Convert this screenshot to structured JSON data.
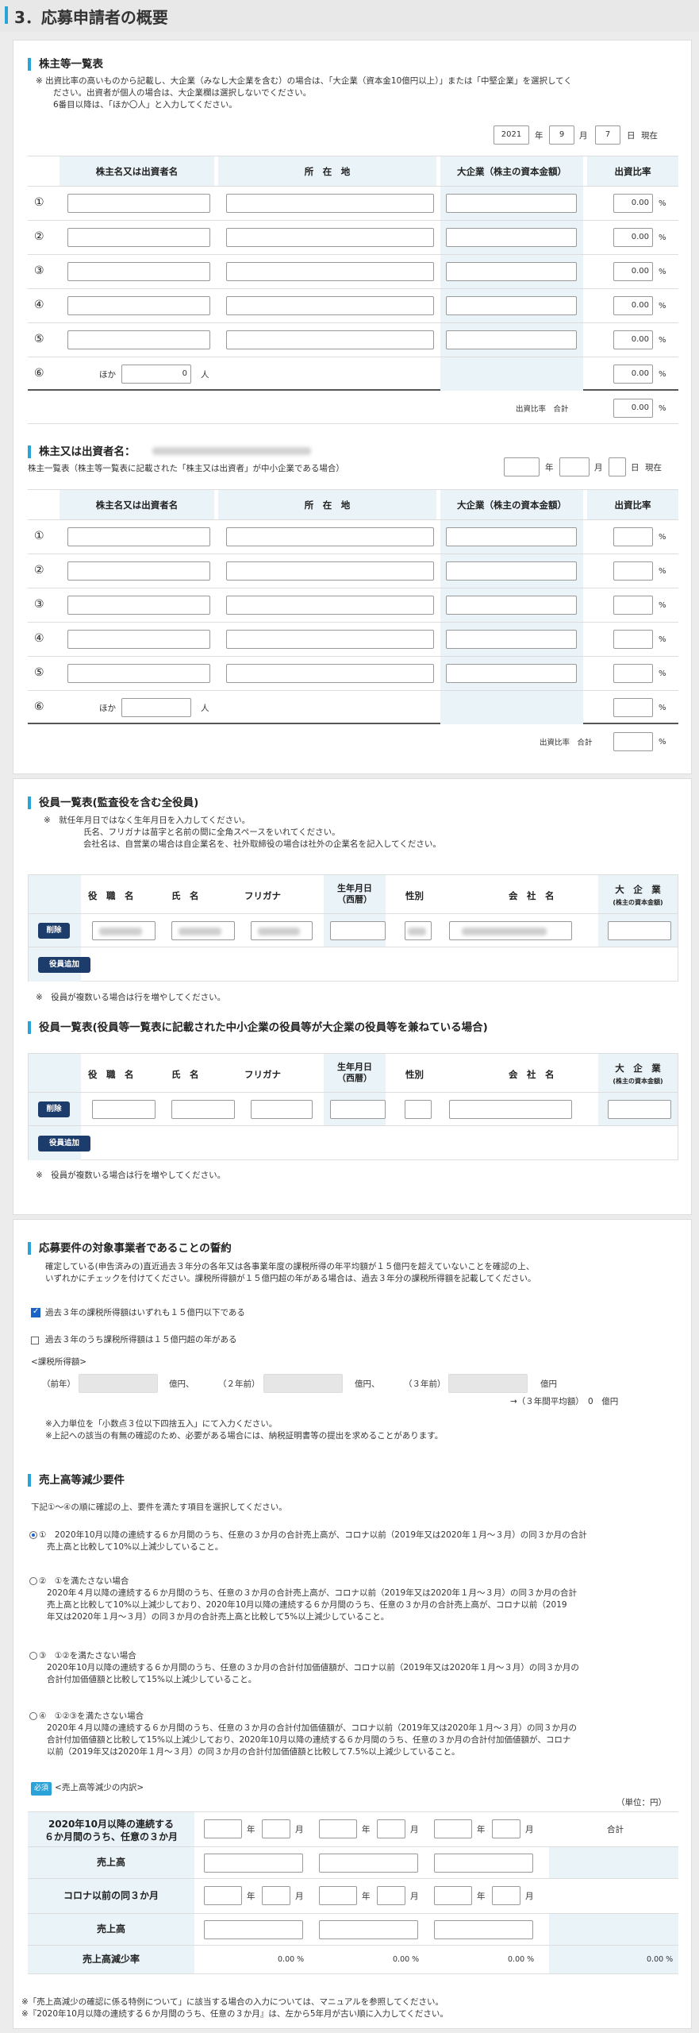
{
  "page_title": "3．応募申請者の概要",
  "s1": {
    "heading": "株主等一覧表",
    "note1": "※ 出資比率の高いものから記載し、大企業（みなし大企業を含む）の場合は、「大企業（資本金10億円以上）」または「中堅企業」を選択してく",
    "note2": "ださい。出資者が個人の場合は、大企業欄は選択しないでください。",
    "note3": "6番目以降は、「ほか〇人」と入力してください。",
    "year": "2021",
    "month": "9",
    "day": "7",
    "date_labels": {
      "y": "年",
      "m": "月",
      "d": "日",
      "now": "現在"
    },
    "cols": [
      "株主名又は出資者名",
      "所　在　地",
      "大企業（株主の資本金額）",
      "出資比率"
    ],
    "rows": [
      "①",
      "②",
      "③",
      "④",
      "⑤",
      "⑥"
    ],
    "ratio": "0.00",
    "pct_sign": "%",
    "others_prefix": "ほか",
    "others_value": "0",
    "others_suffix": "人",
    "total_label": "出資比率　合計",
    "total_value": "0.00"
  },
  "s2": {
    "heading": "株主又は出資者名：",
    "note": "株主一覧表（株主等一覧表に記載された「株主又は出資者」が中小企業である場合）",
    "date_labels": {
      "y": "年",
      "m": "月",
      "d": "日",
      "now": "現在"
    },
    "cols": [
      "株主名又は出資者名",
      "所　在　地",
      "大企業（株主の資本金額）",
      "出資比率"
    ],
    "rows": [
      "①",
      "②",
      "③",
      "④",
      "⑤",
      "⑥"
    ],
    "pct_sign": "%",
    "others_prefix": "ほか",
    "others_suffix": "人",
    "total_label": "出資比率　合計"
  },
  "s3": {
    "heading": "役員一覧表(監査役を含む全役員)",
    "note1": "※　就任年月日ではなく生年月日を入力してください。",
    "note2": "氏名、フリガナは苗字と名前の間に全角スペースをいれてください。",
    "note3": "会社名は、自営業の場合は自企業名を、社外取締役の場合は社外の企業名を記入してください。",
    "cols": [
      "役　職　名",
      "氏　名",
      "フリガナ",
      "生年月日\n（西暦）",
      "性別",
      "会　社　名",
      "大　企　業"
    ],
    "col_sub": "(株主の資本金額)",
    "delete": "削除",
    "add": "役員追加",
    "footer": "※　役員が複数いる場合は行を増やしてください。"
  },
  "s4": {
    "heading": "役員一覧表(役員等一覧表に記載された中小企業の役員等が大企業の役員等を兼ねている場合)",
    "cols": [
      "役　職　名",
      "氏　名",
      "フリガナ",
      "生年月日\n（西暦）",
      "性別",
      "会　社　名",
      "大　企　業"
    ],
    "col_sub": "(株主の資本金額)",
    "delete": "削除",
    "add": "役員追加",
    "footer": "※　役員が複数いる場合は行を増やしてください。"
  },
  "s5": {
    "heading": "応募要件の対象事業者であることの誓約",
    "note1": "確定している(申告済みの)直近過去３年分の各年又は各事業年度の課税所得の年平均額が１５億円を超えていないことを確認の上、",
    "note2": "いずれかにチェックを付けてください。課税所得額が１５億円超の年がある場合は、過去３年分の課税所得額を記載してください。",
    "opt1": "過去３年の課税所得額はいずれも１５億円以下である",
    "opt2": "過去３年のうち課税所得額は１５億円超の年がある",
    "income_label": "<課税所得額>",
    "prev": "（前年）",
    "two": "（２年前）",
    "three": "（３年前）",
    "unit": "億円、",
    "unit_last": "億円",
    "avg": "→（３年間平均額）　0　億円",
    "n1": "※入力単位を「小数点３位以下四捨五入」にて入力ください。",
    "n2": "※上記への該当の有無の確認のため、必要がある場合には、納税証明書等の提出を求めることがあります。"
  },
  "s6": {
    "heading": "売上高等減少要件",
    "intro": "下記①～④の順に確認の上、要件を満たす項目を選択してください。",
    "o1a": "①　2020年10月以降の連続する６か月間のうち、任意の３か月の合計売上高が、コロナ以前（2019年又は2020年１月～３月）の同３か月の合計",
    "o1b": "売上高と比較して10%以上減少していること。",
    "o2t": "②　①を満たさない場合",
    "o2a": "2020年４月以降の連続する６か月間のうち、任意の３か月の合計売上高が、コロナ以前（2019年又は2020年１月～３月）の同３か月の合計",
    "o2b": "売上高と比較して10%以上減少しており、2020年10月以降の連続する６か月間のうち、任意の３か月の合計売上高が、コロナ以前（2019",
    "o2c": "年又は2020年１月～３月）の同３か月の合計売上高と比較して5%以上減少していること。",
    "o3t": "③　①②を満たさない場合",
    "o3a": "2020年10月以降の連続する６か月間のうち、任意の３か月の合計付加価値額が、コロナ以前（2019年又は2020年１月～３月）の同３か月の",
    "o3b": "合計付加価値額と比較して15%以上減少していること。",
    "o4t": "④　①②③を満たさない場合",
    "o4a": "2020年４月以降の連続する６か月間のうち、任意の３か月の合計付加価値額が、コロナ以前（2019年又は2020年１月～３月）の同３か月の",
    "o4b": "合計付加価値額と比較して15%以上減少しており、2020年10月以降の連続する６か月間のうち、任意の３か月の合計付加価値額が、コロナ",
    "o4c": "以前（2019年又は2020年１月～３月）の同３か月の合計付加価値額と比較して7.5%以上減少していること。",
    "req": "必須",
    "table_label": "<売上高等減少の内訳>",
    "unit": "（単位：円）",
    "r1a": "2020年10月以降の連続する",
    "r1b": "６か月間のうち、任意の３か月",
    "r2": "売上高",
    "r3": "コロナ以前の同３か月",
    "r4": "売上高",
    "r5": "売上高減少率",
    "total": "合計",
    "y": "年",
    "m": "月",
    "rate": "0.00 %",
    "f1": "※「売上高減少の確認に係る特例について」に該当する場合の入力については、マニュアルを参照してください。",
    "f2": "※『2020年10月以降の連続する６か月間のうち、任意の３か月』は、左から5年月が古い順に入力してください。"
  }
}
